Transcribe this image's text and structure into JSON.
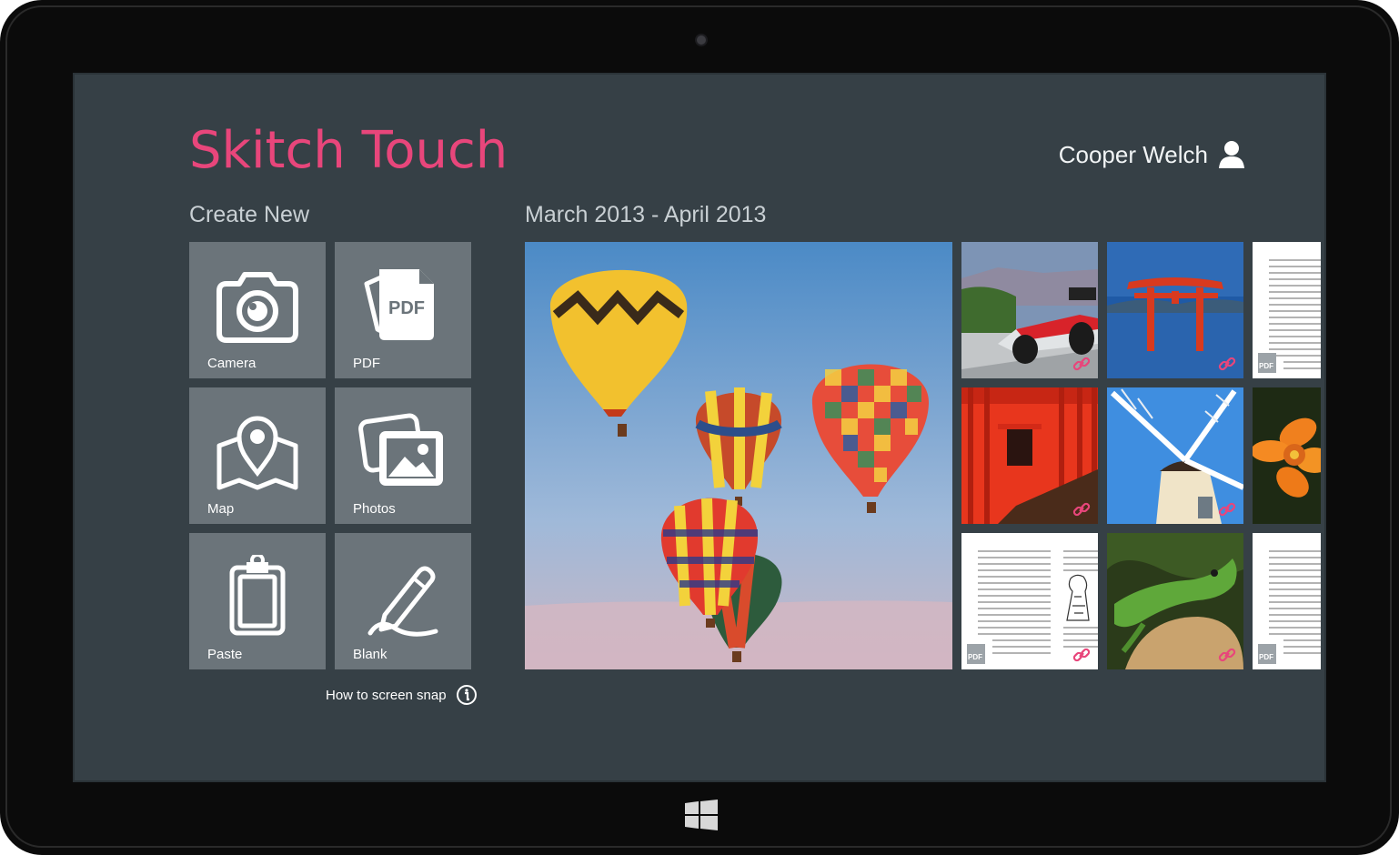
{
  "app": {
    "title": "Skitch Touch",
    "accent_color": "#e8467b"
  },
  "user": {
    "name": "Cooper Welch",
    "icon": "user-icon"
  },
  "create_new": {
    "heading": "Create New",
    "tiles": [
      {
        "label": "Camera",
        "icon": "camera-icon"
      },
      {
        "label": "PDF",
        "icon": "pdf-icon",
        "icon_text": "PDF"
      },
      {
        "label": "Map",
        "icon": "map-pin-icon"
      },
      {
        "label": "Photos",
        "icon": "photos-icon"
      },
      {
        "label": "Paste",
        "icon": "clipboard-icon"
      },
      {
        "label": "Blank",
        "icon": "pen-icon"
      }
    ],
    "help_link": "How to screen snap"
  },
  "gallery": {
    "date_range": "March 2013 - April 2013",
    "items": [
      {
        "subject": "hot-air-balloons",
        "badge": ""
      },
      {
        "subject": "race-car",
        "badge": "link"
      },
      {
        "subject": "torii-gate",
        "badge": "link"
      },
      {
        "subject": "document",
        "badge": "pdf",
        "badge_text": "PDF"
      },
      {
        "subject": "red-torii-tunnel",
        "badge": "link"
      },
      {
        "subject": "windmill",
        "badge": "link"
      },
      {
        "subject": "orange-flower",
        "badge": ""
      },
      {
        "subject": "document-illustrated",
        "badge": "pdf",
        "badge_text": "PDF"
      },
      {
        "subject": "lizard",
        "badge": "link"
      },
      {
        "subject": "document",
        "badge": "pdf",
        "badge_text": "PDF"
      }
    ]
  },
  "colors": {
    "screen_bg": "#364046",
    "tile_bg": "#6b747a",
    "text_primary": "#ffffff",
    "text_secondary": "#c9d0d4"
  }
}
